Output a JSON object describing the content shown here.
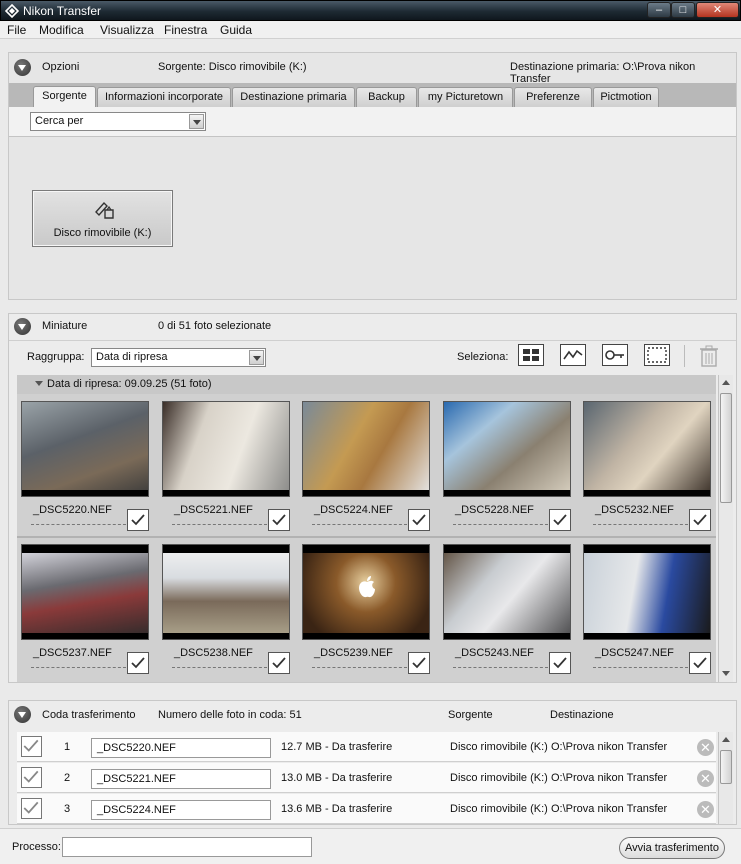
{
  "window": {
    "title": "Nikon Transfer"
  },
  "menu": [
    "File",
    "Modifica",
    "Visualizza",
    "Finestra",
    "Guida"
  ],
  "options": {
    "label": "Opzioni",
    "source_text": "Sorgente: Disco rimovibile (K:)",
    "destination_text": "Destinazione primaria: O:\\Prova nikon Transfer",
    "tabs": [
      "Sorgente",
      "Informazioni incorporate",
      "Destinazione primaria",
      "Backup",
      "my Picturetown",
      "Preferenze",
      "Pictmotion"
    ],
    "active_tab": "Sorgente",
    "search_by": "Cerca per",
    "source_button": "Disco rimovibile (K:)"
  },
  "thumbnails": {
    "label": "Miniature",
    "selected_count": "0 di 51 foto selezionate",
    "group_label": "Raggruppa:",
    "group_value": "Data di ripresa",
    "select_label": "Seleziona:",
    "group_header": "Data di ripresa: 09.09.25 (51 foto)",
    "items": [
      {
        "name": "_DSC5220.NEF",
        "checked": true
      },
      {
        "name": "_DSC5221.NEF",
        "checked": true
      },
      {
        "name": "_DSC5224.NEF",
        "checked": true
      },
      {
        "name": "_DSC5228.NEF",
        "checked": true
      },
      {
        "name": "_DSC5232.NEF",
        "checked": true
      },
      {
        "name": "_DSC5237.NEF",
        "checked": true
      },
      {
        "name": "_DSC5238.NEF",
        "checked": true
      },
      {
        "name": "_DSC5239.NEF",
        "checked": true
      },
      {
        "name": "_DSC5243.NEF",
        "checked": true
      },
      {
        "name": "_DSC5247.NEF",
        "checked": true
      }
    ]
  },
  "queue": {
    "label": "Coda trasferimento",
    "count_text": "Numero delle foto in coda: 51",
    "col_source": "Sorgente",
    "col_destination": "Destinazione",
    "rows": [
      {
        "num": "1",
        "name": "_DSC5220.NEF",
        "size": "12.7 MB - Da trasferire",
        "source": "Disco rimovibile (K:)",
        "dest": "O:\\Prova nikon Transfer"
      },
      {
        "num": "2",
        "name": "_DSC5221.NEF",
        "size": "13.0 MB - Da trasferire",
        "source": "Disco rimovibile (K:)",
        "dest": "O:\\Prova nikon Transfer"
      },
      {
        "num": "3",
        "name": "_DSC5224.NEF",
        "size": "13.6 MB - Da trasferire",
        "source": "Disco rimovibile (K:)",
        "dest": "O:\\Prova nikon Transfer"
      }
    ]
  },
  "footer": {
    "process_label": "Processo:",
    "start_button": "Avvia trasferimento"
  },
  "colors": {
    "titlebar": "#1e2a33",
    "close_button": "#b43420"
  }
}
